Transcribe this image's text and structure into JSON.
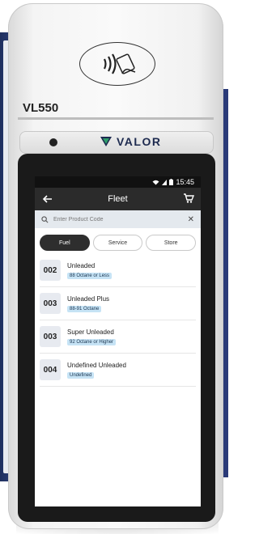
{
  "device": {
    "model": "VL550",
    "brand": "VALOR"
  },
  "status_bar": {
    "time": "15:45",
    "icons": [
      "wifi-icon",
      "signal-icon",
      "battery-icon"
    ]
  },
  "app_bar": {
    "title": "Fleet",
    "back_icon": "arrow-left-icon",
    "cart_icon": "cart-icon"
  },
  "search": {
    "placeholder": "Enter Product Code",
    "value": ""
  },
  "tabs": [
    {
      "label": "Fuel",
      "active": true
    },
    {
      "label": "Service",
      "active": false
    },
    {
      "label": "Store",
      "active": false
    }
  ],
  "products": [
    {
      "code": "002",
      "name": "Unleaded",
      "badge": "88 Octane or Less"
    },
    {
      "code": "003",
      "name": "Unleaded Plus",
      "badge": "88-91 Octane"
    },
    {
      "code": "003",
      "name": "Super Unleaded",
      "badge": "92 Octane or Higher"
    },
    {
      "code": "004",
      "name": "Undefined Unleaded",
      "badge": "Undefined"
    }
  ],
  "colors": {
    "app_bar": "#2b2b2b",
    "badge": "#c6e3f5",
    "brand": "#1d2a4f",
    "logo_accent": "#2e9e6a"
  }
}
